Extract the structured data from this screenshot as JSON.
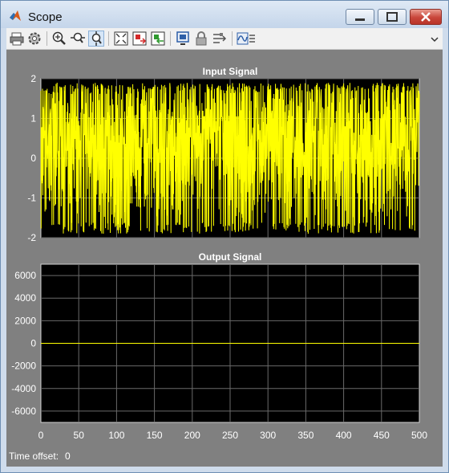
{
  "window": {
    "title": "Scope",
    "controls": {
      "minimize": "minimize",
      "maximize": "maximize",
      "close": "close"
    }
  },
  "toolbar": {
    "icons": [
      "print-icon",
      "parameters-gear-icon",
      "zoom-in-icon",
      "zoom-x-icon",
      "zoom-y-icon",
      "autoscale-icon",
      "save-axes-icon",
      "restore-axes-icon",
      "floating-scope-icon",
      "lock-axes-icon",
      "signal-selection-icon",
      "scope-parameters-icon"
    ]
  },
  "status": {
    "label": "Time offset:",
    "value": "0"
  },
  "colors": {
    "plot_bg": "#000000",
    "frame_bg": "#808080",
    "signal": "#ffff00",
    "grid": "#6a6a6a",
    "text": "#ffffff"
  },
  "chart_data": [
    {
      "type": "line",
      "title": "Input Signal",
      "xlabel": "",
      "ylabel": "",
      "xlim": [
        0,
        500
      ],
      "ylim": [
        -2,
        2
      ],
      "yticks": [
        "2",
        "1",
        "0",
        "-1",
        "-2"
      ],
      "xticks": [],
      "grid": true,
      "series": [
        {
          "waveform": "rapid oscillation between about -1.9 and 1.9",
          "amplitude": 1.9
        }
      ]
    },
    {
      "type": "line",
      "title": "Output Signal",
      "xlabel": "",
      "ylabel": "",
      "xlim": [
        0,
        500
      ],
      "ylim": [
        -7000,
        7000
      ],
      "yticks": [
        "6000",
        "4000",
        "2000",
        "0",
        "-2000",
        "-4000",
        "-6000"
      ],
      "xticks": [
        "0",
        "50",
        "100",
        "150",
        "200",
        "250",
        "300",
        "350",
        "400",
        "450",
        "500"
      ],
      "grid": true,
      "series": [
        {
          "x": [
            0,
            500
          ],
          "y": [
            0,
            0
          ]
        }
      ]
    }
  ]
}
